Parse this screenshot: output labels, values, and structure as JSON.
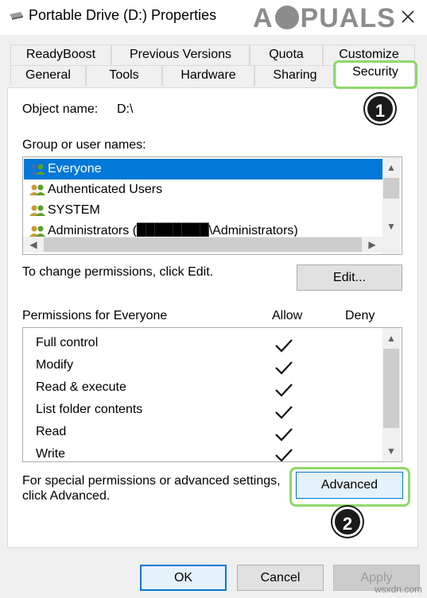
{
  "window": {
    "title": "Portable Drive (D:) Properties",
    "watermark": "APPUALS"
  },
  "tabs": {
    "row1": [
      "ReadyBoost",
      "Previous Versions",
      "Quota",
      "Customize"
    ],
    "row2": [
      "General",
      "Tools",
      "Hardware",
      "Sharing",
      "Security"
    ],
    "active": "Security"
  },
  "security": {
    "object_name_label": "Object name:",
    "object_name_value": "D:\\",
    "group_label": "Group or user names:",
    "users": [
      {
        "name": "Everyone",
        "selected": true
      },
      {
        "name": "Authenticated Users",
        "selected": false
      },
      {
        "name": "SYSTEM",
        "selected": false
      },
      {
        "name": "Administrators (████████\\Administrators)",
        "selected": false
      }
    ],
    "change_text": "To change permissions, click Edit.",
    "edit_label": "Edit...",
    "permissions_label": "Permissions for Everyone",
    "allow_label": "Allow",
    "deny_label": "Deny",
    "permissions": [
      {
        "name": "Full control",
        "allow": true,
        "deny": false
      },
      {
        "name": "Modify",
        "allow": true,
        "deny": false
      },
      {
        "name": "Read & execute",
        "allow": true,
        "deny": false
      },
      {
        "name": "List folder contents",
        "allow": true,
        "deny": false
      },
      {
        "name": "Read",
        "allow": true,
        "deny": false
      },
      {
        "name": "Write",
        "allow": true,
        "deny": false
      }
    ],
    "special_text_1": "For special permissions or advanced settings,",
    "special_text_2": "click Advanced.",
    "advanced_label": "Advanced"
  },
  "markers": {
    "one": "1",
    "two": "2"
  },
  "footer": {
    "ok": "OK",
    "cancel": "Cancel",
    "apply": "Apply"
  },
  "site": "wsxdn.com",
  "colors": {
    "selection": "#0078d7",
    "highlight": "#8ed86a"
  }
}
